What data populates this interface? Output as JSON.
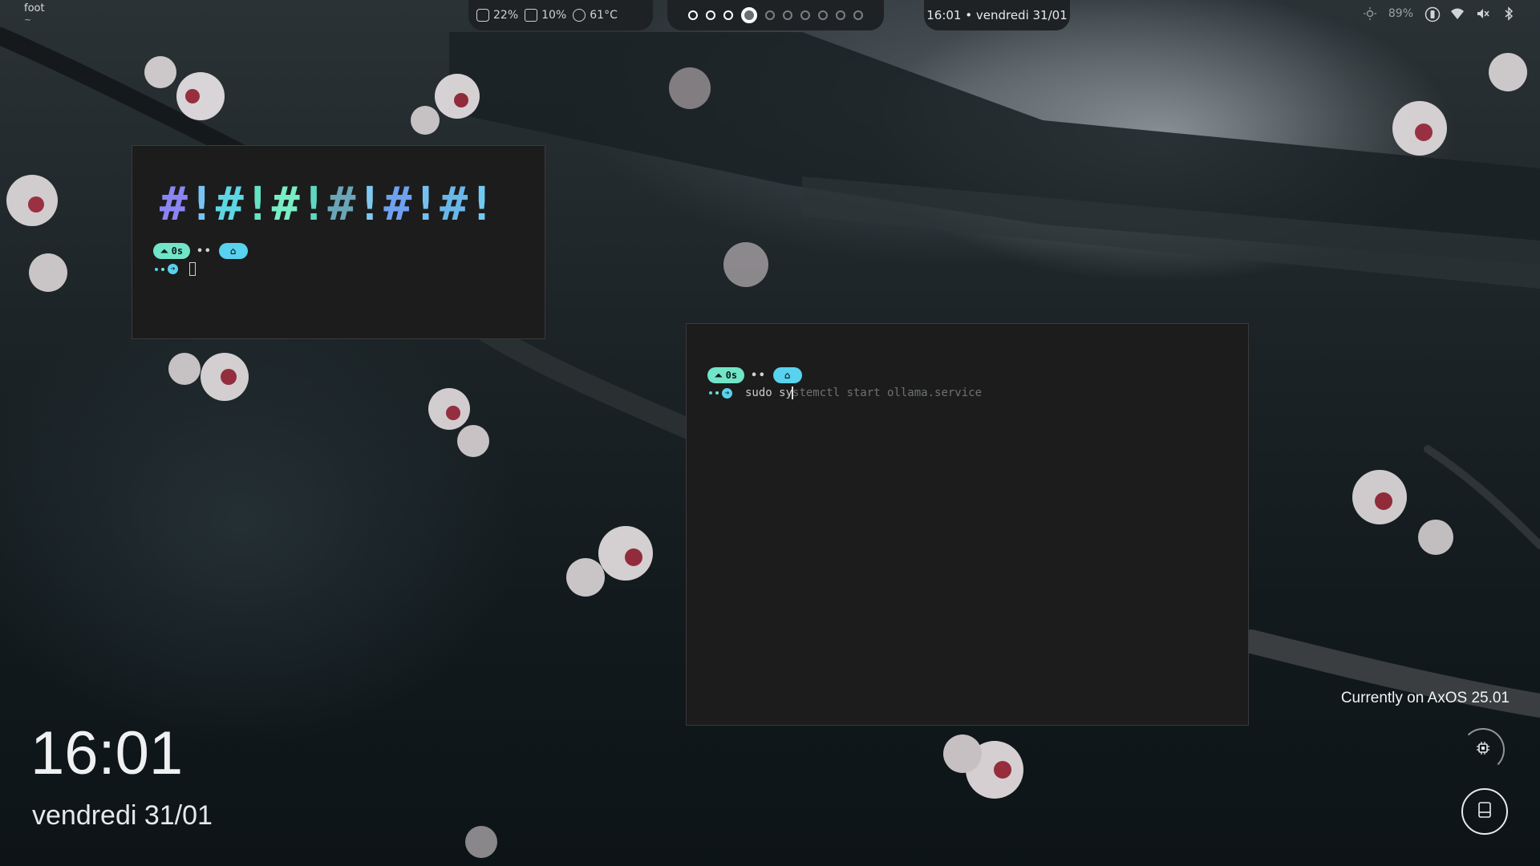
{
  "topbar": {
    "app_title": "foot",
    "app_subtitle": "~",
    "stats": [
      {
        "icon": "cpu-icon",
        "value": "22%"
      },
      {
        "icon": "memory-icon",
        "value": "10%"
      },
      {
        "icon": "temperature-icon",
        "value": "61°C"
      }
    ],
    "workspaces": {
      "count": 10,
      "active": 4,
      "occupied": [
        1,
        2,
        3,
        4
      ]
    },
    "clock": "16:01 • vendredi 31/01",
    "battery": "89%",
    "tray_icons": [
      "brightness-icon",
      "battery-icon",
      "wifi-icon",
      "volume-muted-icon",
      "bluetooth-icon"
    ]
  },
  "terminal_small": {
    "banner": [
      {
        "text": "#",
        "color": "#8a85f2"
      },
      {
        "text": "!",
        "color": "#77c3f4"
      },
      {
        "text": "#",
        "color": "#5fd6e3"
      },
      {
        "text": "!",
        "color": "#66e3c4"
      },
      {
        "text": "#",
        "color": "#79edc6"
      },
      {
        "text": "!",
        "color": "#5ed8c0"
      },
      {
        "text": "#",
        "color": "#6aa5b8"
      },
      {
        "text": "!",
        "color": "#7fc8f0"
      },
      {
        "text": "#",
        "color": "#6fa1f0"
      },
      {
        "text": "!",
        "color": "#75c0f2"
      },
      {
        "text": "#",
        "color": "#68b7e8"
      },
      {
        "text": "!",
        "color": "#72c9f0"
      }
    ],
    "prompt_time": "0s",
    "prompt_dots": "••"
  },
  "terminal_large": {
    "prompt_time": "0s",
    "prompt_dots": "••",
    "command_typed": "sudo sy",
    "command_suggestion": "stemctl start ollama.service"
  },
  "desktop": {
    "time": "16:01",
    "date": "vendredi 31/01",
    "os_label": "Currently on AxOS 25.01"
  },
  "colors": {
    "chip_time": "#72e5c8",
    "chip_home": "#58d2ee",
    "terminal_bg": "#1c1c1c"
  }
}
